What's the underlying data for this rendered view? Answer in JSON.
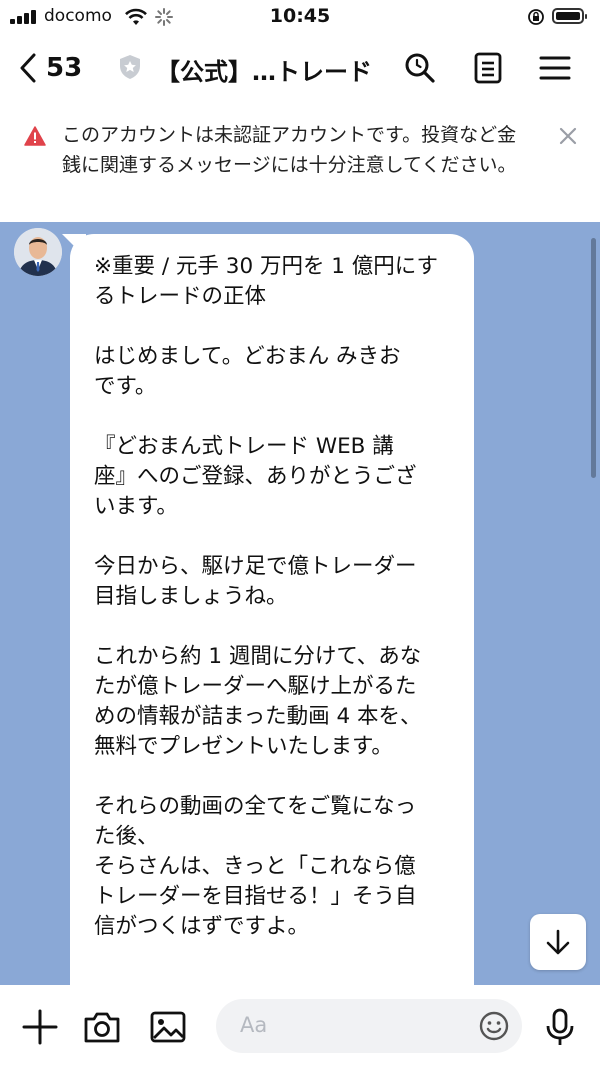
{
  "status_bar": {
    "carrier": "docomo",
    "time": "10:45",
    "icons": [
      "signal-icon",
      "wifi-icon",
      "loading-icon",
      "rotation-lock-icon",
      "battery-icon"
    ]
  },
  "header": {
    "back_count": "53",
    "title": "【公式】…トレード",
    "icons": [
      "chevron-left-icon",
      "shield-icon",
      "search-icon",
      "notes-icon",
      "menu-icon"
    ]
  },
  "warning": {
    "text": "このアカウントは未認証アカウントです。投資など金銭に関連するメッセージには十分注意してください。",
    "icons": [
      "warning-icon",
      "close-icon"
    ]
  },
  "message": {
    "paragraphs": [
      "※重要 / 元手 30 万円を 1 億円にす\nるトレードの正体",
      "はじめまして。どおまん みきお\nです。",
      "『どおまん式トレード WEB 講\n座』へのご登録、ありがとうござ\nいます。",
      "今日から、駆け足で億トレーダー\n目指しましょうね。",
      "これから約 1 週間に分けて、あな\nたが億トレーダーへ駆け上がるた\nめの情報が詰まった動画 4 本を、\n無料でプレゼントいたします。",
      "それらの動画の全てをご覧になっ\nた後、\nそらさんは、きっと「これなら億\nトレーダーを目指せる！」そう自\n信がつくはずですよ。"
    ]
  },
  "input": {
    "placeholder": "Aa",
    "icons": [
      "plus-icon",
      "camera-icon",
      "image-icon",
      "emoji-icon",
      "microphone-icon",
      "arrow-down-icon"
    ]
  },
  "colors": {
    "chat_background": "#8aa8d6",
    "warning_red": "#e0434b"
  }
}
